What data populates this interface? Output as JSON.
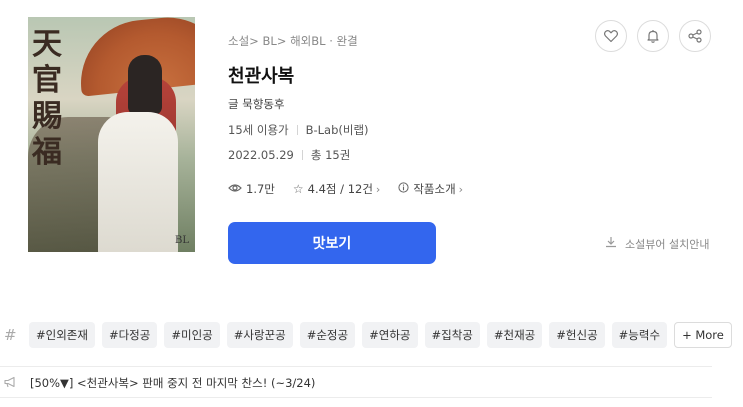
{
  "cover": {
    "title_glyph_1": "天",
    "title_glyph_2": "官",
    "title_glyph_3": "賜",
    "title_glyph_4": "福",
    "publisher_mark": "BL"
  },
  "breadcrumb": {
    "items": [
      "소설",
      "BL",
      "해외BL"
    ],
    "separator": ">",
    "status": "완결"
  },
  "book": {
    "title": "천관사복",
    "author": "글 묵향동후",
    "age_rating": "15세 이용가",
    "publisher": "B-Lab(비랩)",
    "date": "2022.05.29",
    "volumes": "총 15권"
  },
  "stats": {
    "views": "1.7만",
    "rating": "4.4점 / 12건",
    "intro": "작품소개"
  },
  "actions": {
    "preview_label": "맛보기",
    "install_label": "소설뷰어 설치안내"
  },
  "icons": {
    "like": "heart-icon",
    "alarm": "bell-icon",
    "share": "share-icon",
    "views": "eye-icon",
    "rating": "star-icon",
    "intro": "info-icon",
    "install": "download-icon",
    "tags": "hash-icon",
    "notice": "megaphone-icon"
  },
  "tags": {
    "hash_symbol": "#",
    "items": [
      "#인외존재",
      "#다정공",
      "#미인공",
      "#사랑꾼공",
      "#순정공",
      "#연하공",
      "#집착공",
      "#천재공",
      "#헌신공",
      "#능력수"
    ],
    "more_label": "+ More"
  },
  "notice": {
    "text": "[50%▼] <천관사복> 판매 중지 전 마지막 찬스! (~3/24)"
  },
  "colors": {
    "primary": "#3366ee",
    "tag_bg": "#f1f2f4",
    "muted": "#888888"
  }
}
